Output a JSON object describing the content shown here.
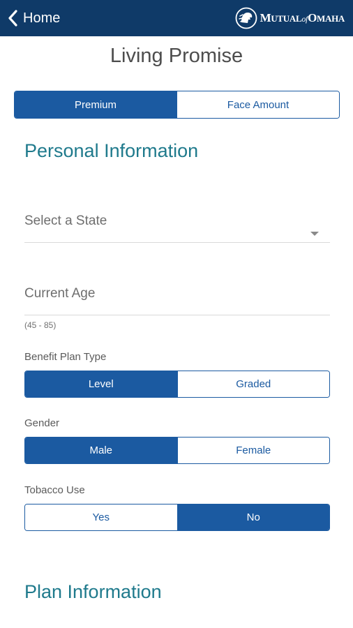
{
  "nav": {
    "back_label": "Home",
    "brand_small_1": "M",
    "brand_rest_1": "UTUAL",
    "brand_of": "of",
    "brand_small_2": "O",
    "brand_rest_2": "MAHA"
  },
  "page": {
    "title": "Living Promise"
  },
  "mode_toggle": {
    "options": [
      "Premium",
      "Face Amount"
    ],
    "selected": "Premium"
  },
  "personal": {
    "heading": "Personal Information",
    "state": {
      "placeholder": "Select a State"
    },
    "age": {
      "placeholder": "Current Age",
      "hint": "(45 - 85)"
    },
    "benefit_plan": {
      "label": "Benefit Plan Type",
      "options": [
        "Level",
        "Graded"
      ],
      "selected": "Level"
    },
    "gender": {
      "label": "Gender",
      "options": [
        "Male",
        "Female"
      ],
      "selected": "Male"
    },
    "tobacco": {
      "label": "Tobacco Use",
      "options": [
        "Yes",
        "No"
      ],
      "selected": "No"
    }
  },
  "plan": {
    "heading": "Plan Information"
  },
  "colors": {
    "nav_bg": "#0f3a68",
    "accent": "#1b5aa1",
    "heading": "#1f7a8c"
  },
  "icons": {
    "back": "chevron-left-icon",
    "logo": "lion-logo-icon",
    "dropdown": "caret-down-icon"
  }
}
